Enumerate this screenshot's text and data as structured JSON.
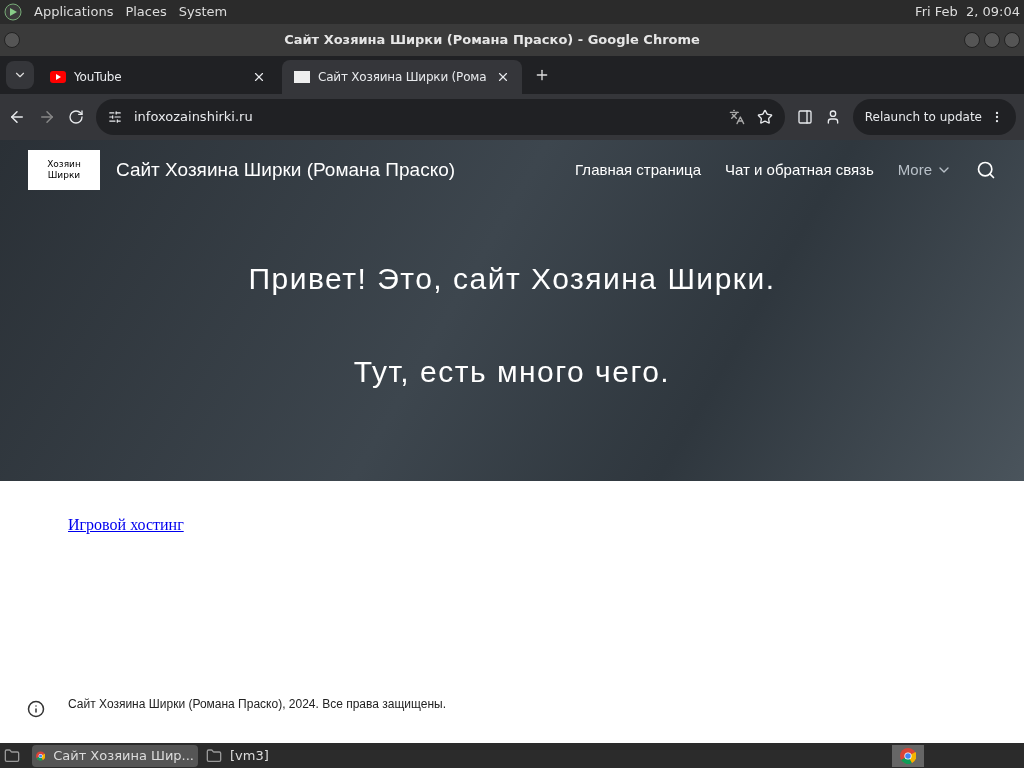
{
  "top_panel": {
    "menus": [
      "Applications",
      "Places",
      "System"
    ],
    "clock": "Fri Feb  2, 09:04"
  },
  "window": {
    "title": "Сайт Хозяина Ширки (Романа Праско) - Google Chrome"
  },
  "tabs": [
    {
      "label": "YouTube",
      "kind": "youtube",
      "selected": false
    },
    {
      "label": "Сайт Хозяина Ширки (Рома",
      "kind": "page",
      "selected": true
    }
  ],
  "toolbar": {
    "url": "infoxozainshirki.ru",
    "relaunch": "Relaunch to update"
  },
  "site": {
    "logo_lines": [
      "Хозяин",
      "Ширки"
    ],
    "title": "Сайт Хозяина Ширки (Романа Праско)",
    "nav": [
      {
        "label": "Главная страница",
        "kind": "link"
      },
      {
        "label": "Чат и обратная связь",
        "kind": "link"
      },
      {
        "label": "More",
        "kind": "more"
      }
    ],
    "hero": [
      "Привет! Это, сайт Хозяина Ширки.",
      "Тут, есть много чего."
    ],
    "image_link": "Игровой хостинг",
    "footer": "Сайт Хозяина Ширки (Романа Праско), 2024. Все права защищены."
  },
  "taskbar": {
    "windows": [
      {
        "label": "Сайт Хозяина Шир...",
        "kind": "chrome",
        "selected": true
      },
      {
        "label": "[vm3]",
        "kind": "folder",
        "selected": false
      }
    ]
  }
}
